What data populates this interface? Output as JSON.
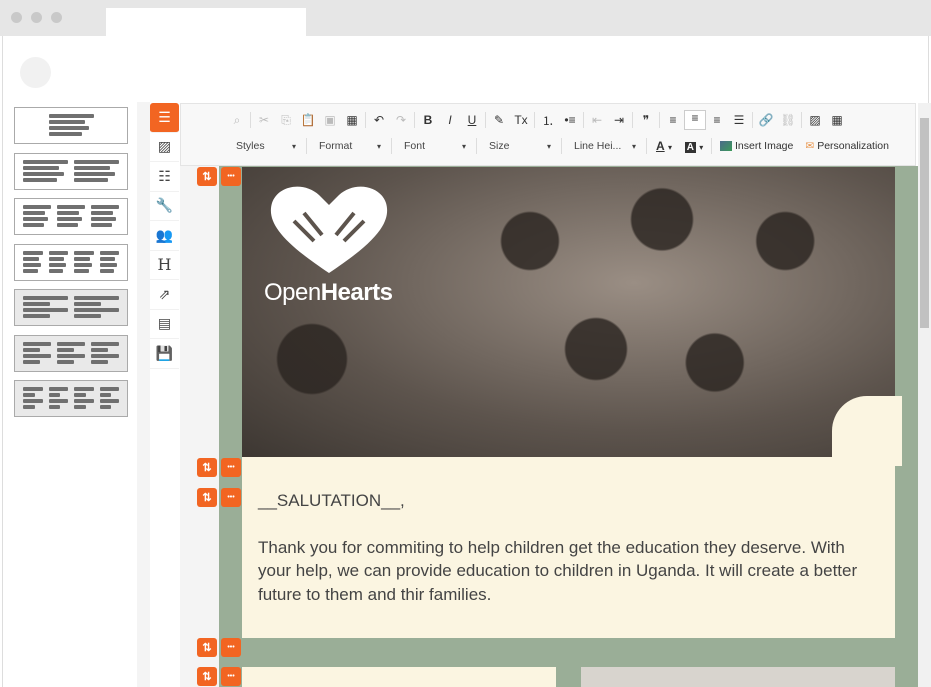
{
  "window": {
    "tab_title": ""
  },
  "layouts": [
    {
      "cols": 1,
      "style": "boxed"
    },
    {
      "cols": 2,
      "style": "boxed"
    },
    {
      "cols": 3,
      "style": "boxed"
    },
    {
      "cols": 4,
      "style": "boxed"
    },
    {
      "cols": 2,
      "style": "filled"
    },
    {
      "cols": 3,
      "style": "filled"
    },
    {
      "cols": 4,
      "style": "filled"
    }
  ],
  "side_tools": [
    {
      "icon": "rows-icon",
      "glyph": "☰"
    },
    {
      "icon": "image-icon",
      "glyph": "▨"
    },
    {
      "icon": "list-icon",
      "glyph": "☷"
    },
    {
      "icon": "wrench-icon",
      "glyph": "🔧"
    },
    {
      "icon": "users-icon",
      "glyph": "👥"
    },
    {
      "icon": "heading-icon",
      "glyph": "H"
    },
    {
      "icon": "link-out-icon",
      "glyph": "⇗"
    },
    {
      "icon": "newsletter-icon",
      "glyph": "▤"
    },
    {
      "icon": "save-icon",
      "glyph": "💾"
    }
  ],
  "toolbar": {
    "row1": [
      {
        "icon": "find-icon",
        "glyph": "⌕",
        "disabled": true
      },
      {
        "sep": true
      },
      {
        "icon": "cut-icon",
        "glyph": "✂",
        "disabled": true
      },
      {
        "icon": "copy-icon",
        "glyph": "⎘",
        "disabled": true
      },
      {
        "icon": "paste-icon",
        "glyph": "📋",
        "disabled": true
      },
      {
        "icon": "paste-text-icon",
        "glyph": "▣",
        "disabled": true
      },
      {
        "icon": "paste-word-icon",
        "glyph": "▦",
        "disabled": false
      },
      {
        "sep": true
      },
      {
        "icon": "undo-icon",
        "glyph": "↶",
        "disabled": false
      },
      {
        "icon": "redo-icon",
        "glyph": "↷",
        "disabled": true
      },
      {
        "sep": true
      },
      {
        "icon": "bold-icon",
        "glyph": "B",
        "disabled": false
      },
      {
        "icon": "italic-icon",
        "glyph": "I",
        "disabled": false
      },
      {
        "icon": "underline-icon",
        "glyph": "U",
        "disabled": false
      },
      {
        "sep": true
      },
      {
        "icon": "format-painter-icon",
        "glyph": "✎",
        "disabled": false
      },
      {
        "icon": "clear-format-icon",
        "glyph": "Tx",
        "disabled": false
      },
      {
        "sep": true
      },
      {
        "icon": "numbered-list-icon",
        "glyph": "⒈",
        "disabled": false
      },
      {
        "icon": "bulleted-list-icon",
        "glyph": "•≡",
        "disabled": false
      },
      {
        "sep": true
      },
      {
        "icon": "outdent-icon",
        "glyph": "⇤",
        "disabled": true
      },
      {
        "icon": "indent-icon",
        "glyph": "⇥",
        "disabled": false
      },
      {
        "sep": true
      },
      {
        "icon": "blockquote-icon",
        "glyph": "❞",
        "disabled": false
      },
      {
        "sep": true
      },
      {
        "icon": "align-left-icon",
        "glyph": "≡",
        "disabled": false
      },
      {
        "icon": "align-center-icon",
        "glyph": "≡",
        "disabled": false,
        "active": true
      },
      {
        "icon": "align-right-icon",
        "glyph": "≡",
        "disabled": false
      },
      {
        "icon": "justify-icon",
        "glyph": "☰",
        "disabled": false
      },
      {
        "sep": true
      },
      {
        "icon": "link-icon",
        "glyph": "🔗",
        "disabled": false
      },
      {
        "icon": "unlink-icon",
        "glyph": "⛓",
        "disabled": true
      },
      {
        "sep": true
      },
      {
        "icon": "image-icon",
        "glyph": "▨",
        "disabled": false
      },
      {
        "icon": "table-icon",
        "glyph": "▦",
        "disabled": false
      }
    ],
    "dropdowns": [
      {
        "label": "Styles"
      },
      {
        "label": "Format"
      },
      {
        "label": "Font"
      },
      {
        "label": "Size"
      },
      {
        "label": "Line Hei..."
      }
    ],
    "text_color": "A",
    "bg_color": "A",
    "insert_image": "Insert Image",
    "personalization": "Personalization"
  },
  "email": {
    "logo_text_light": "Open",
    "logo_text_bold": "Hearts",
    "salutation": "__SALUTATION__,",
    "body": "Thank you for commiting to help children get the education they deserve. With your help, we can provide education to children in Uganda. It will create a better future to them and thir families.",
    "colors": {
      "accent": "#f26522",
      "green": "#9aae97",
      "cream": "#fbf5e1"
    }
  },
  "handle": {
    "move_glyph": "⇅",
    "more_glyph": "•••"
  }
}
